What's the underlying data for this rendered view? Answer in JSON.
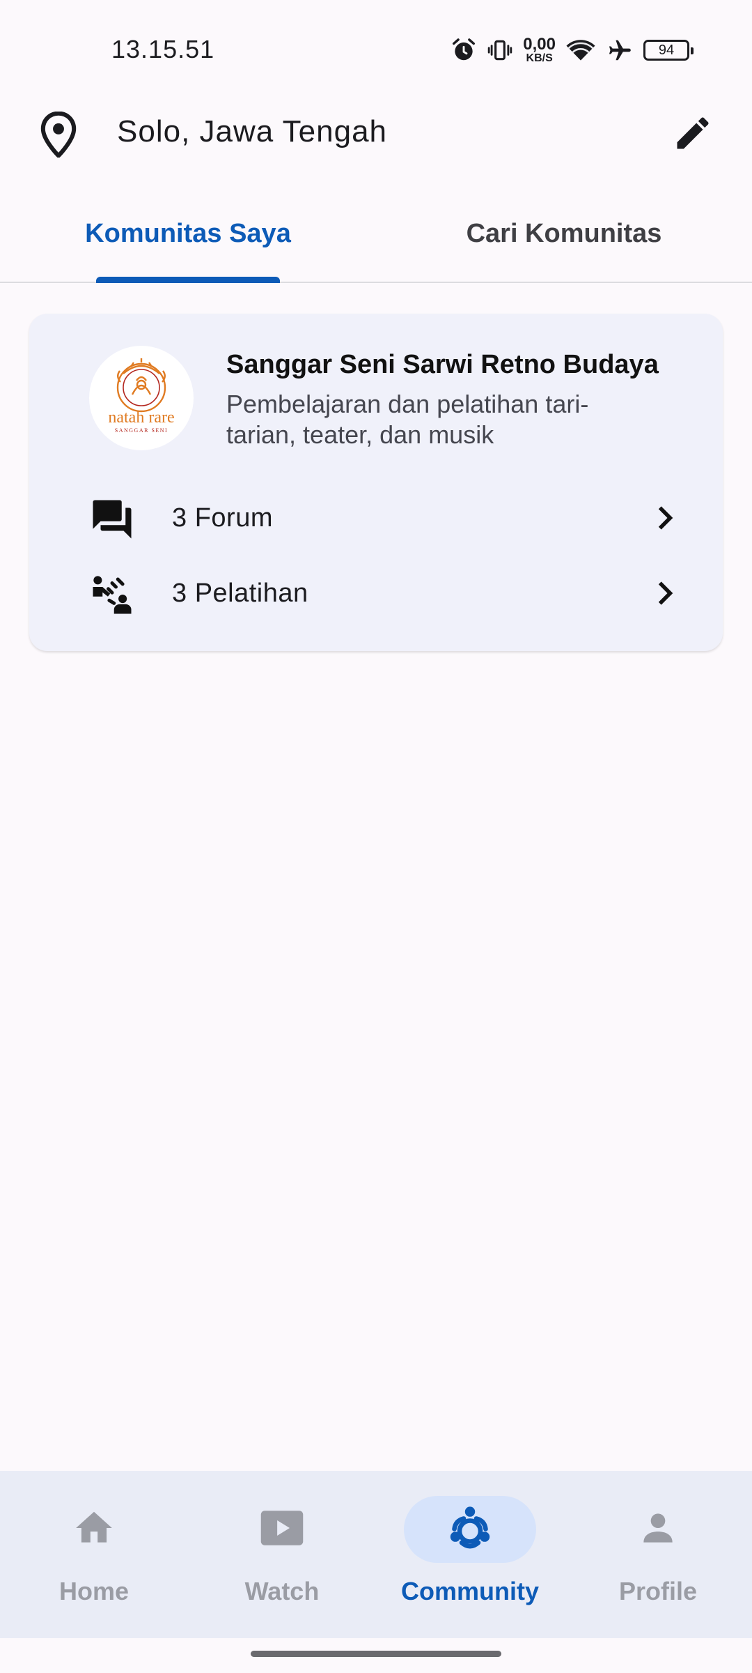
{
  "status_bar": {
    "time": "13.15.51",
    "net_speed_value": "0,00",
    "net_speed_unit": "KB/S",
    "battery": "94",
    "icons": [
      "alarm-icon",
      "vibrate-icon",
      "wifi-icon",
      "airplane-icon",
      "battery-icon"
    ]
  },
  "location": {
    "text": "Solo, Jawa Tengah",
    "pin_icon": "location-pin-icon",
    "edit_icon": "pencil-icon"
  },
  "tabs": [
    {
      "label": "Komunitas Saya",
      "active": true
    },
    {
      "label": "Cari Komunitas",
      "active": false
    }
  ],
  "community_card": {
    "logo_text": "natah rare",
    "logo_subtext": "SANGGAR SENI",
    "title": "Sanggar Seni Sarwi Retno Budaya",
    "description": "Pembelajaran dan pelatihan tari-tarian, teater, dan musik",
    "rows": [
      {
        "label": "3 Forum",
        "icon": "forum-icon"
      },
      {
        "label": "3 Pelatihan",
        "icon": "training-icon"
      }
    ]
  },
  "bottom_nav": {
    "items": [
      {
        "label": "Home",
        "icon": "home-icon",
        "active": false
      },
      {
        "label": "Watch",
        "icon": "play-icon",
        "active": false
      },
      {
        "label": "Community",
        "icon": "community-icon",
        "active": true
      },
      {
        "label": "Profile",
        "icon": "person-icon",
        "active": false
      }
    ]
  },
  "colors": {
    "accent": "#0D5BB7",
    "background": "#FCF9FC",
    "card": "#F0F1FA",
    "nav_background": "#E9ECF6",
    "nav_active_pill": "#D6E3FB",
    "nav_inactive": "#9A9CA4",
    "logo_orange": "#E07B22",
    "logo_red": "#B3261E"
  }
}
